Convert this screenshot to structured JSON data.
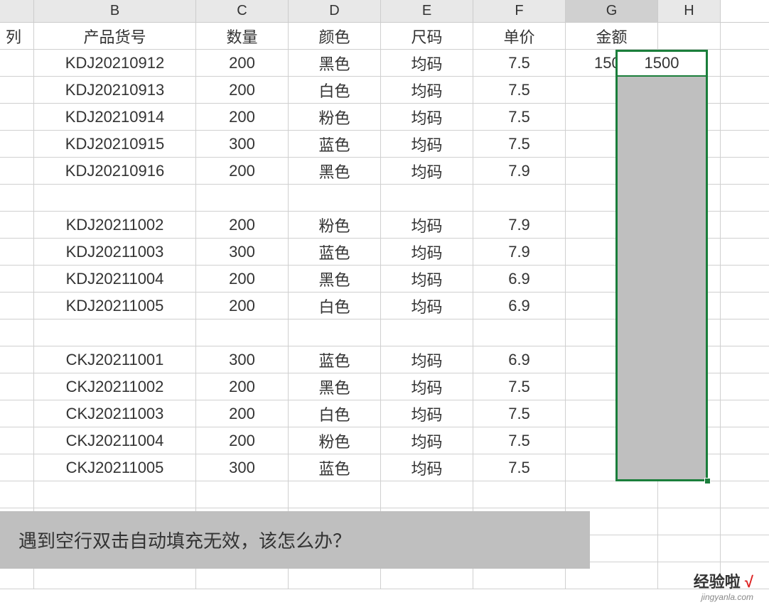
{
  "columns": [
    "",
    "B",
    "C",
    "D",
    "E",
    "F",
    "G",
    "H"
  ],
  "columnWidths": [
    "w-a",
    "w-b",
    "w-s",
    "w-s",
    "w-s",
    "w-s",
    "w-s",
    "w-h"
  ],
  "selectedCol": "G",
  "partialText": "列",
  "headers": [
    "产品货号",
    "数量",
    "颜色",
    "尺码",
    "单价",
    "金额"
  ],
  "rows": [
    {
      "b": "KDJ20210912",
      "c": "200",
      "d": "黑色",
      "e": "均码",
      "f": "7.5",
      "g": "1500"
    },
    {
      "b": "KDJ20210913",
      "c": "200",
      "d": "白色",
      "e": "均码",
      "f": "7.5",
      "g": ""
    },
    {
      "b": "KDJ20210914",
      "c": "200",
      "d": "粉色",
      "e": "均码",
      "f": "7.5",
      "g": ""
    },
    {
      "b": "KDJ20210915",
      "c": "300",
      "d": "蓝色",
      "e": "均码",
      "f": "7.5",
      "g": ""
    },
    {
      "b": "KDJ20210916",
      "c": "200",
      "d": "黑色",
      "e": "均码",
      "f": "7.9",
      "g": ""
    },
    {
      "b": "",
      "c": "",
      "d": "",
      "e": "",
      "f": "",
      "g": ""
    },
    {
      "b": "KDJ20211002",
      "c": "200",
      "d": "粉色",
      "e": "均码",
      "f": "7.9",
      "g": ""
    },
    {
      "b": "KDJ20211003",
      "c": "300",
      "d": "蓝色",
      "e": "均码",
      "f": "7.9",
      "g": ""
    },
    {
      "b": "KDJ20211004",
      "c": "200",
      "d": "黑色",
      "e": "均码",
      "f": "6.9",
      "g": ""
    },
    {
      "b": "KDJ20211005",
      "c": "200",
      "d": "白色",
      "e": "均码",
      "f": "6.9",
      "g": ""
    },
    {
      "b": "",
      "c": "",
      "d": "",
      "e": "",
      "f": "",
      "g": ""
    },
    {
      "b": "CKJ20211001",
      "c": "300",
      "d": "蓝色",
      "e": "均码",
      "f": "6.9",
      "g": ""
    },
    {
      "b": "CKJ20211002",
      "c": "200",
      "d": "黑色",
      "e": "均码",
      "f": "7.5",
      "g": ""
    },
    {
      "b": "CKJ20211003",
      "c": "200",
      "d": "白色",
      "e": "均码",
      "f": "7.5",
      "g": ""
    },
    {
      "b": "CKJ20211004",
      "c": "200",
      "d": "粉色",
      "e": "均码",
      "f": "7.5",
      "g": ""
    },
    {
      "b": "CKJ20211005",
      "c": "300",
      "d": "蓝色",
      "e": "均码",
      "f": "7.5",
      "g": ""
    }
  ],
  "emptyRows": 4,
  "selection": {
    "value": "1500"
  },
  "caption": "遇到空行双击自动填充无效，该怎么办？",
  "watermark": {
    "text": "经验啦",
    "check": "√",
    "sub": "jingyanla.com"
  }
}
